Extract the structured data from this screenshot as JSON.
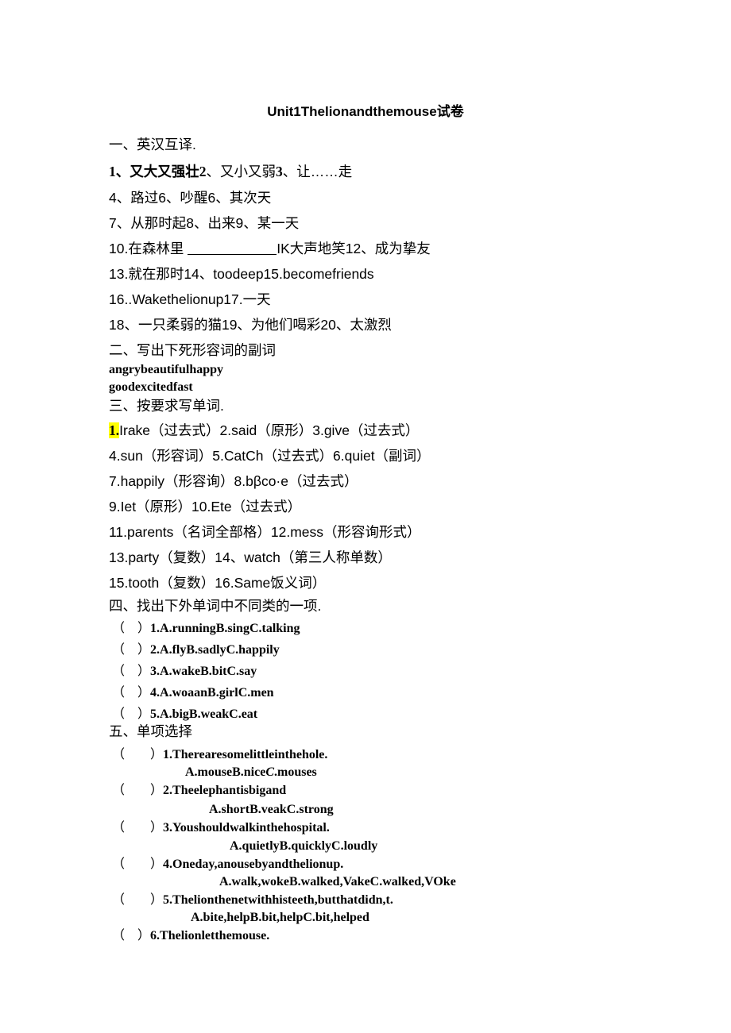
{
  "document": {
    "title": "Unit1Thelionandthemouse试卷",
    "highlight_color": "#ffff00"
  },
  "sections": [
    {
      "heading": "一、英汉互译.",
      "lines": [
        {
          "cn": "1、又大又强壮",
          "num2": "2",
          "cn2": "、又小又弱",
          "num3": "3",
          "cn3": "、让……走"
        },
        {
          "text": "4、路过6、吵醒6、其次天"
        },
        {
          "text": "7、从那时起8、出来9、某一天"
        },
        {
          "text_a": "10.在森林里 ",
          "blank": true,
          "text_b": "IK大声地笑12、成为挚友"
        },
        {
          "text": "13.就在那时14、toodeep15.becomefriends"
        },
        {
          "text": "16..Wakethelionup17.一天"
        },
        {
          "text": "18、一只柔弱的猫19、为他们喝彩20、太激烈"
        }
      ]
    },
    {
      "heading": "二、写出下死形容词的副词",
      "lines": [
        {
          "text": "angrybeautifulhappy"
        },
        {
          "text": "goodexcitedfast"
        }
      ]
    },
    {
      "heading": "三、按要求写单词.",
      "lines": [
        {
          "hl": "1.",
          "text": "Irake（过去式）2.said（原形）3.give（过去式）"
        },
        {
          "text": "4.sun（形容词）5.CatCh（过去式）6.quiet（副词）"
        },
        {
          "text": "7.happily（形容询）8.bβco·e（过去式）"
        },
        {
          "text": "9.Iet（原形）10.Ete（过去式）"
        },
        {
          "text": "11.parents（名词全部格）12.mess（形容询形式）"
        },
        {
          "text": "13.party（复数）14、watch（第三人称单数）"
        },
        {
          "text": "15.tooth（复数）16.Same饭义词）"
        }
      ]
    },
    {
      "heading": "四、找出下外单词中不同类的一项.",
      "items": [
        {
          "bracket": "（　）",
          "text": "1.A.runningB.singC.talking"
        },
        {
          "bracket": "（　）",
          "text": "2.A.flyB.sadlyC.happily"
        },
        {
          "bracket": "（　）",
          "text": "3.A.wakeB.bitC.say"
        },
        {
          "bracket": "（　）",
          "text": "4.A.woaanB.girlC.men"
        },
        {
          "bracket": "（　）",
          "text": "5.A.bigB.weakC.eat"
        }
      ]
    },
    {
      "heading": "五、单项选择",
      "items": [
        {
          "bracket": "（　　）",
          "question": "1.Therearesomelittleinthehole.",
          "answers_pre": "A.mouseB.nice",
          "answers_ital": "C",
          "answers_post": ".mouses"
        },
        {
          "bracket": "（　　）",
          "question": "2.Theelephantisbigand",
          "answers": "A.shortB.veakC.strong"
        },
        {
          "bracket": "（　　）",
          "question": "3.Youshouldwalkinthehospital.",
          "answers": "A.quietlyB.quicklyC.loudly"
        },
        {
          "bracket": "（　　）",
          "question": "4.Oneday,anousebyandthelionup.",
          "answers": "A.walk,wokeB.walked,VakeC.walked,VOke"
        },
        {
          "bracket": "（　　）",
          "question": "5.Thelionthenetwithhisteeth,butthatdidn,t.",
          "answers": "A.bite,helpB.bit,helpC.bit,helped"
        },
        {
          "bracket": "（　）",
          "question": "6.Thelionletthemouse.",
          "answers": ""
        }
      ]
    }
  ]
}
